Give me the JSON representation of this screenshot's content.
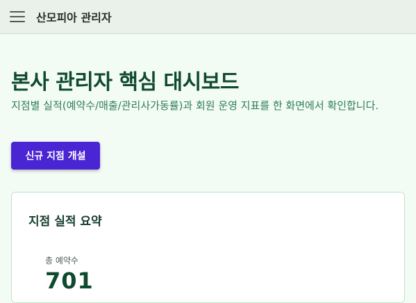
{
  "header": {
    "app_title": "산모피아 관리자"
  },
  "main": {
    "title": "본사 관리자 핵심 대시보드",
    "description": "지점별 실적(예약수/매출/관리사가동률)과 회원 운영 지표를 한 화면에서 확인합니다.",
    "new_branch_button": "신규 지점 개설"
  },
  "summary_card": {
    "title": "지점 실적 요약",
    "stats": [
      {
        "label": "총 예약수",
        "value": "701"
      }
    ]
  },
  "colors": {
    "accent": "#4a25d4",
    "heading": "#0f4a2f",
    "text_green": "#2e7d57",
    "background": "#f3fbf5"
  }
}
